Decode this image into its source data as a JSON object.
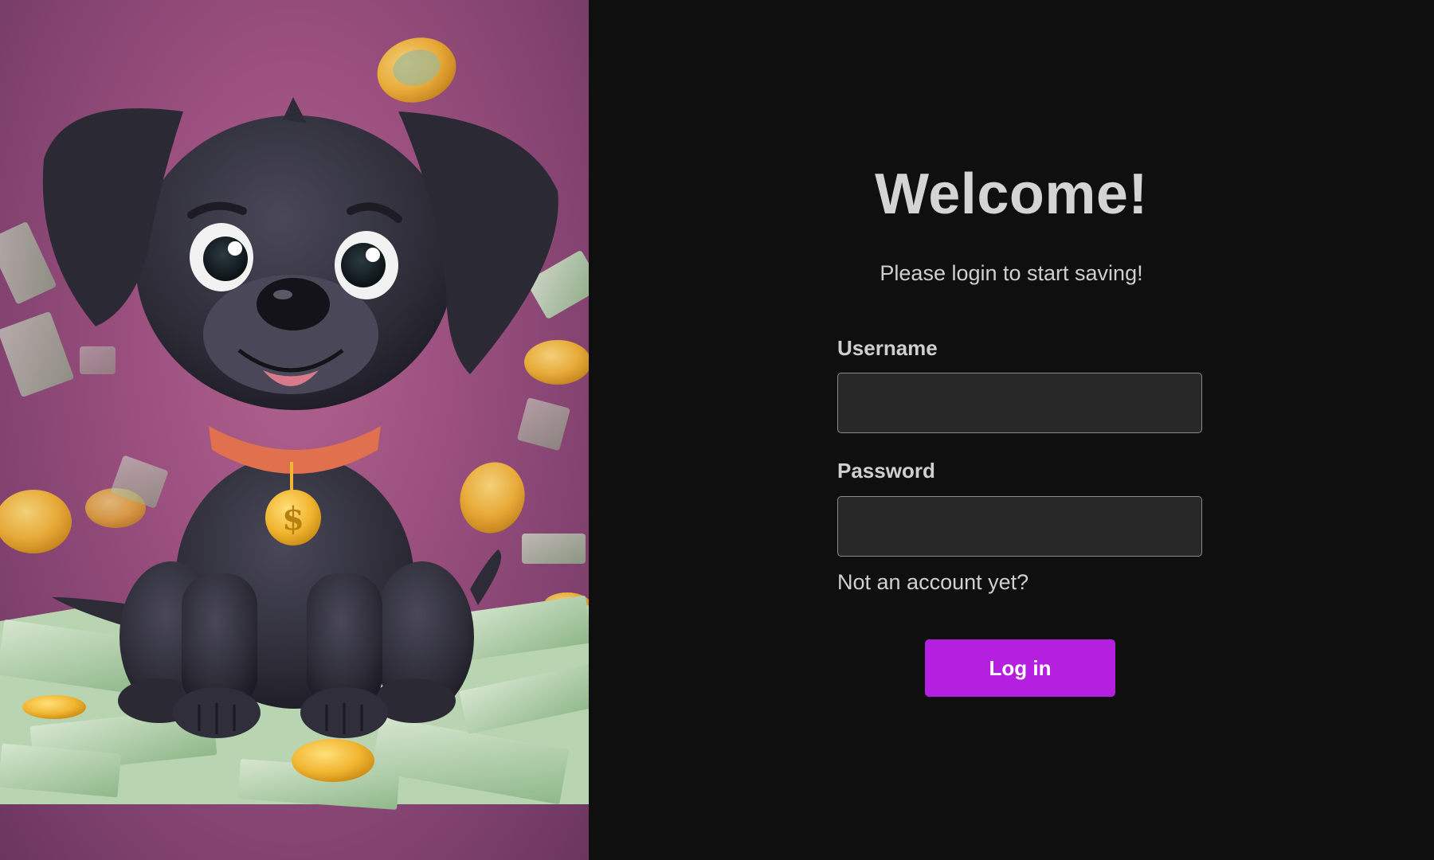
{
  "hero": {
    "image_description_name": "puppy-with-money-illustration",
    "colors": {
      "background": "#9a4f7e",
      "dog_body": "#2c2b36",
      "collar": "#e0704e",
      "coin": "#f2b632",
      "bill": "#a9c9a4"
    }
  },
  "login": {
    "title": "Welcome!",
    "subtitle": "Please login to start saving!",
    "username_label": "Username",
    "username_value": "",
    "password_label": "Password",
    "password_value": "",
    "signup_link": "Not an account yet?",
    "login_button": "Log in"
  },
  "colors": {
    "panel_background": "#0f0f0f",
    "input_background": "#282828",
    "accent": "#b41fe0",
    "text": "#d4d4d4"
  }
}
